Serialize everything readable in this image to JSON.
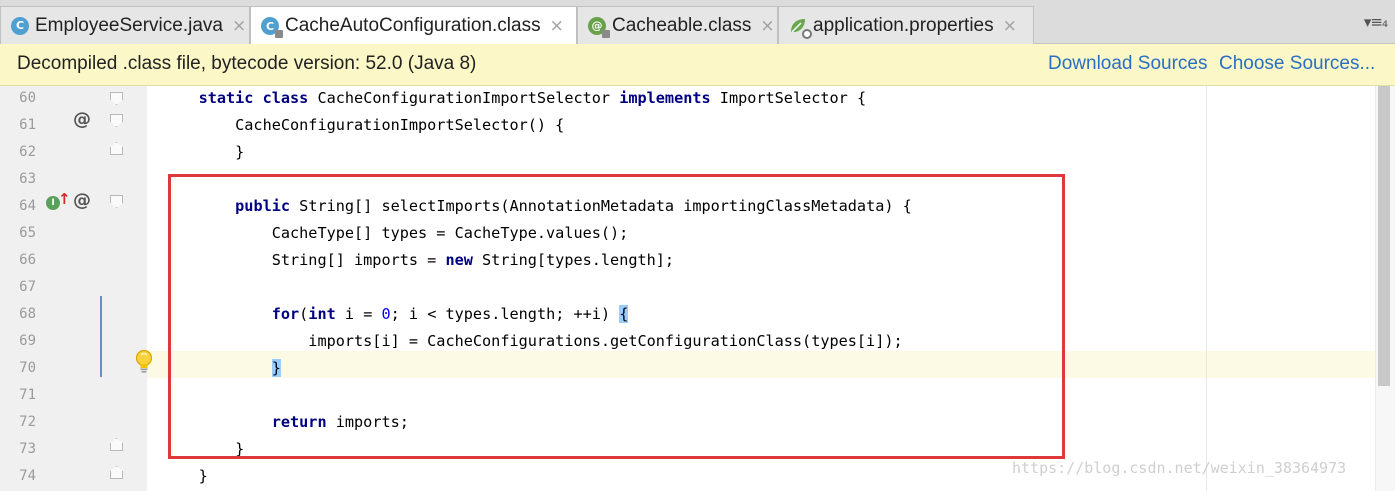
{
  "tabs": [
    {
      "label": "EmployeeService.java",
      "icon": "class-icon",
      "icon_glyph": "C",
      "active": false
    },
    {
      "label": "CacheAutoConfiguration.class",
      "icon": "class-icon",
      "icon_glyph": "C",
      "active": true
    },
    {
      "label": "Cacheable.class",
      "icon": "annotation-icon",
      "icon_glyph": "@",
      "active": false
    },
    {
      "label": "application.properties",
      "icon": "properties-icon",
      "icon_glyph": "",
      "active": false
    }
  ],
  "tab_close_glyph": "×",
  "tab_menu_glyph": "▾≡₄",
  "banner": {
    "text": "Decompiled .class file, bytecode version: 52.0 (Java 8)",
    "download_sources": "Download Sources",
    "choose_sources": "Choose Sources..."
  },
  "lines": [
    {
      "num": "60",
      "code": [
        {
          "t": "    "
        },
        {
          "t": "static",
          "c": "kw"
        },
        {
          "t": " "
        },
        {
          "t": "class",
          "c": "kw"
        },
        {
          "t": " CacheConfigurationImportSelector "
        },
        {
          "t": "implements",
          "c": "kw"
        },
        {
          "t": " ImportSelector {"
        }
      ]
    },
    {
      "num": "61",
      "code": [
        {
          "t": "        CacheConfigurationImportSelector() {"
        }
      ]
    },
    {
      "num": "62",
      "code": [
        {
          "t": "        }"
        }
      ]
    },
    {
      "num": "63",
      "code": []
    },
    {
      "num": "64",
      "code": [
        {
          "t": "        "
        },
        {
          "t": "public",
          "c": "kw"
        },
        {
          "t": " String[] selectImports(AnnotationMetadata importingClassMetadata) {"
        }
      ]
    },
    {
      "num": "65",
      "code": [
        {
          "t": "            CacheType[] types = CacheType.values();"
        }
      ]
    },
    {
      "num": "66",
      "code": [
        {
          "t": "            String[] imports = "
        },
        {
          "t": "new",
          "c": "kw"
        },
        {
          "t": " String[types.length];"
        }
      ]
    },
    {
      "num": "67",
      "code": []
    },
    {
      "num": "68",
      "code": [
        {
          "t": "            "
        },
        {
          "t": "for",
          "c": "kw"
        },
        {
          "t": "("
        },
        {
          "t": "int",
          "c": "kw"
        },
        {
          "t": " i = "
        },
        {
          "t": "0",
          "c": "num"
        },
        {
          "t": "; i < types.length; ++i) "
        },
        {
          "t": "{",
          "c": "brace-match"
        }
      ]
    },
    {
      "num": "69",
      "code": [
        {
          "t": "                imports[i] = CacheConfigurations.getConfigurationClass(types[i]);"
        }
      ]
    },
    {
      "num": "70",
      "code": [
        {
          "t": "            "
        },
        {
          "t": "}",
          "c": "brace-match"
        }
      ]
    },
    {
      "num": "71",
      "code": []
    },
    {
      "num": "72",
      "code": [
        {
          "t": "            "
        },
        {
          "t": "return",
          "c": "kw"
        },
        {
          "t": " imports;"
        }
      ]
    },
    {
      "num": "73",
      "code": [
        {
          "t": "        }"
        }
      ]
    },
    {
      "num": "74",
      "code": [
        {
          "t": "    }"
        }
      ]
    }
  ],
  "gutter_glyphs": {
    "annotation": "@",
    "implements": "I",
    "arrow": "↑"
  },
  "watermark": "https://blog.csdn.net/weixin_38364973",
  "colors": {
    "keyword": "#000080",
    "number": "#0000ff",
    "highlight_box": "#e0383a",
    "link": "#2a6fc6",
    "banner_bg": "#fbf7c7"
  }
}
